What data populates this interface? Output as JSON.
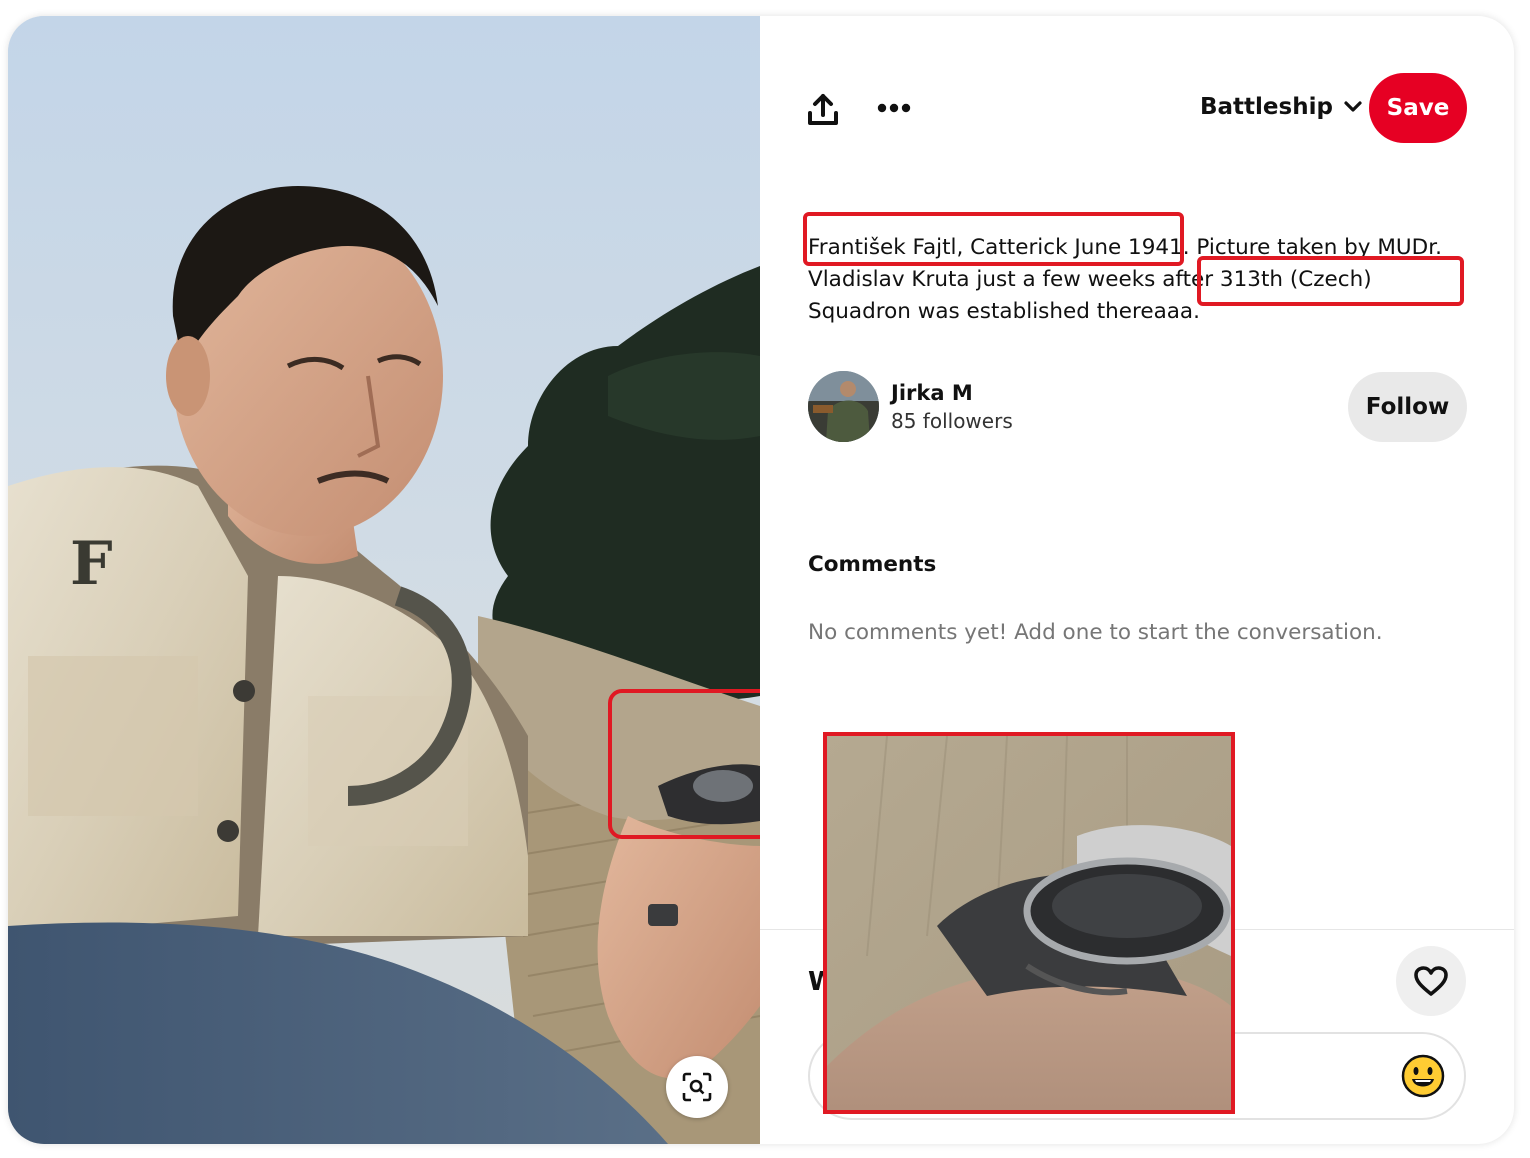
{
  "toolbar": {
    "share_icon": "share-upload-icon",
    "more_icon": "more-options-icon",
    "board_name": "Battleship",
    "board_chevron_icon": "chevron-down-icon",
    "save_label": "Save"
  },
  "pin": {
    "description_parts": [
      "František Fajtl, Catterick June 1941.",
      " Picture taken by MUDr. Vladislav Kruta just a few weeks after ",
      "313th (Czech) Squadron",
      " was established thereaaa."
    ],
    "visual_search_icon": "visual-search-icon"
  },
  "creator": {
    "name": "Jirka M",
    "followers": "85 followers",
    "follow_label": "Follow"
  },
  "comments": {
    "title": "Comments",
    "empty_text": "No comments yet! Add one to start the conversation.",
    "footer_partial": "W",
    "like_icon": "heart-icon",
    "emoji_icon": "emoji-smile-icon"
  },
  "colors": {
    "save_red": "#e60023",
    "annotation_red": "#e01923",
    "follow_bg": "#e9e9e9",
    "muted_text": "#767676"
  }
}
